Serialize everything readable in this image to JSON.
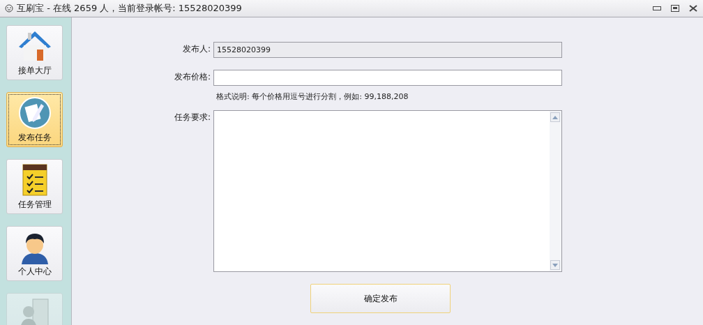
{
  "window": {
    "title": "互刷宝 - 在线 2659 人，当前登录帐号: 15528020399"
  },
  "sidebar": {
    "items": [
      {
        "label": "接单大厅",
        "selected": false,
        "disabled": false
      },
      {
        "label": "发布任务",
        "selected": true,
        "disabled": false
      },
      {
        "label": "任务管理",
        "selected": false,
        "disabled": false
      },
      {
        "label": "个人中心",
        "selected": false,
        "disabled": false
      },
      {
        "selected": false,
        "disabled": true
      }
    ]
  },
  "form": {
    "fields": [
      {
        "kind": "text",
        "label": "发布人:",
        "value": "15528020399",
        "disabled": true
      },
      {
        "kind": "text",
        "label": "发布价格:",
        "disabled": false,
        "hint": "格式说明: 每个价格用逗号进行分割，例如: 99,188,208"
      },
      {
        "kind": "textarea",
        "label": "任务要求:",
        "disabled": false
      }
    ],
    "submit": "确定发布"
  }
}
